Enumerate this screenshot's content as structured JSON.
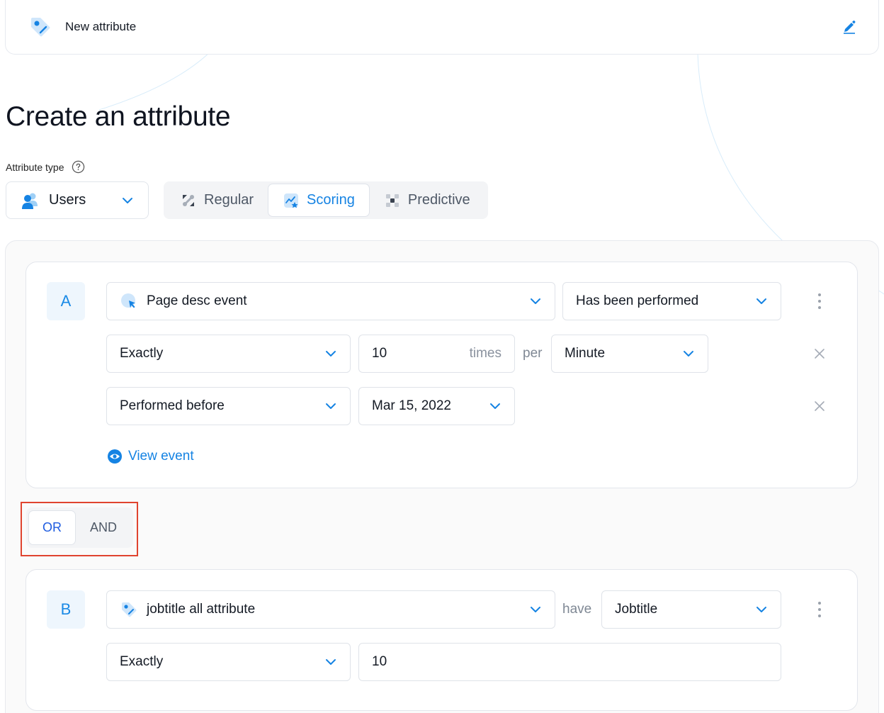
{
  "header": {
    "title": "New attribute",
    "edit_icon": "pencil-icon"
  },
  "page": {
    "title": "Create an attribute"
  },
  "attribute_type": {
    "label": "Attribute type",
    "help_icon": "question-circle-icon",
    "entity_select": {
      "value": "Users",
      "icon": "users-icon"
    },
    "tabs": [
      {
        "label": "Regular",
        "icon": "regular-icon",
        "active": false
      },
      {
        "label": "Scoring",
        "icon": "scoring-icon",
        "active": true
      },
      {
        "label": "Predictive",
        "icon": "predictive-icon",
        "active": false
      }
    ]
  },
  "condition_a": {
    "letter": "A",
    "event_select": {
      "value": "Page desc event",
      "icon": "cursor-click-icon"
    },
    "performed_select": {
      "value": "Has been performed"
    },
    "frequency_operator": {
      "value": "Exactly"
    },
    "frequency_count": {
      "value": "10",
      "suffix": "times"
    },
    "per_label": "per",
    "period_select": {
      "value": "Minute"
    },
    "time_operator": {
      "value": "Performed before"
    },
    "date_select": {
      "value": "Mar 15, 2022"
    },
    "view_event_label": "View event"
  },
  "logic_toggle": {
    "options": [
      "OR",
      "AND"
    ],
    "selected": "OR"
  },
  "condition_b": {
    "letter": "B",
    "attribute_select": {
      "value": "jobtitle all attribute",
      "icon": "attribute-tag-icon"
    },
    "have_label": "have",
    "field_select": {
      "value": "Jobtitle"
    },
    "operator_select": {
      "value": "Exactly"
    },
    "value_input": {
      "value": "10"
    }
  },
  "colors": {
    "accent": "#1583e3",
    "or_text": "#1f5ce0",
    "highlight": "#e0442f"
  }
}
